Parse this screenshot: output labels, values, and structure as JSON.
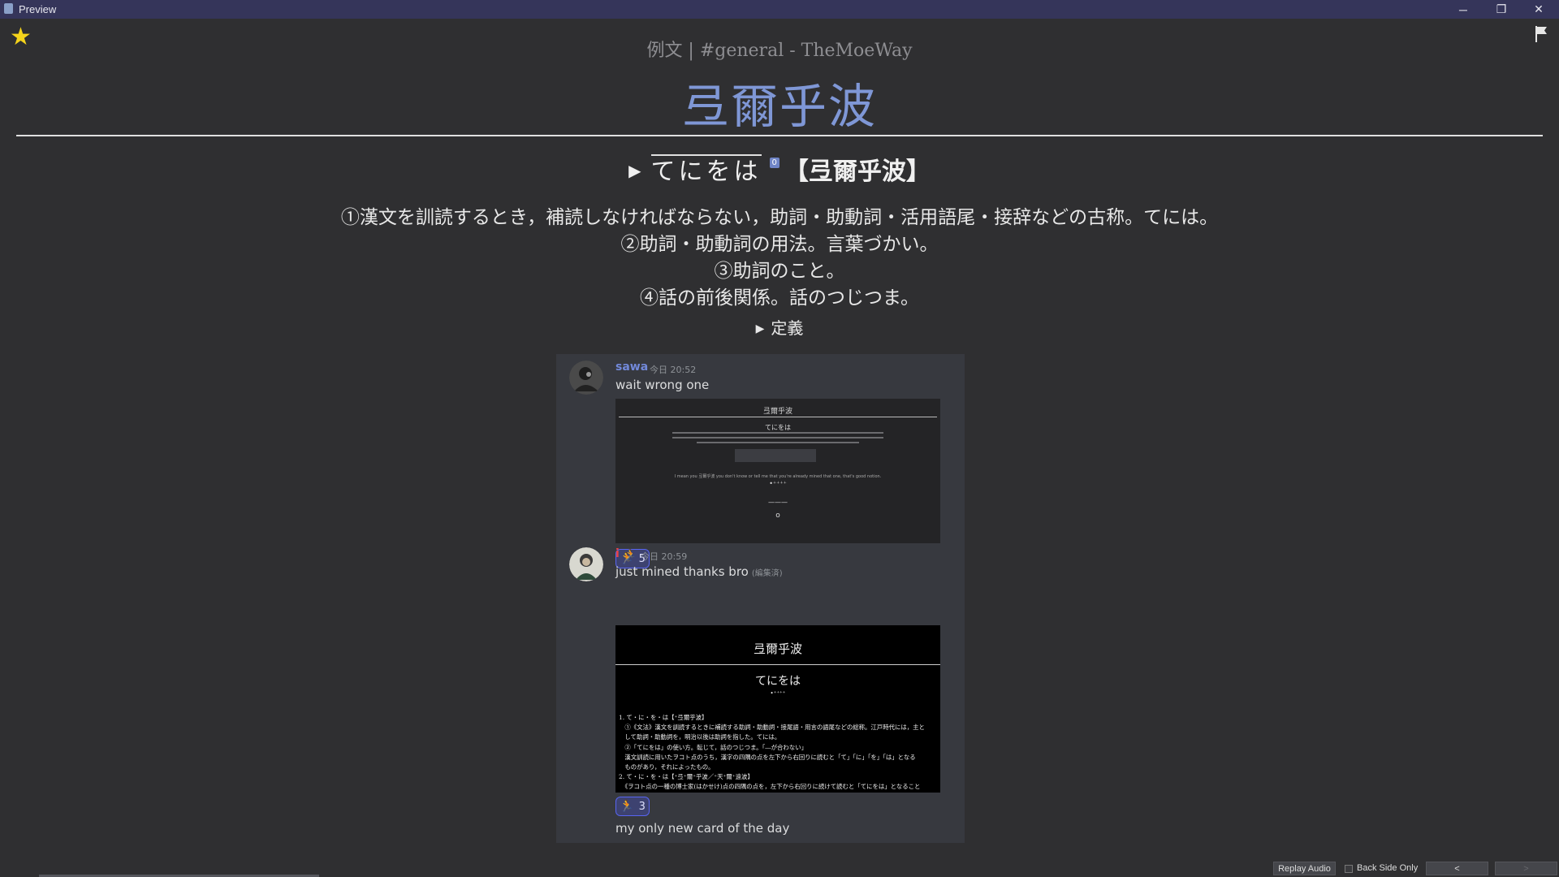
{
  "window": {
    "title": "Preview",
    "minimize_glyph": "─",
    "restore_glyph": "❐",
    "close_glyph": "✕"
  },
  "card": {
    "deck_line": "例文 | #general - TheMoeWay",
    "kanji": "弖爾乎波",
    "reading": "てにをは",
    "pitch_badge": "0",
    "headword": "【弖爾乎波】",
    "definitions": [
      "①漢文を訓読するとき，補読しなければならない，助詞・助動詞・活用語尾・接辞などの古称。てには。",
      "②助詞・助動詞の用法。言葉づかい。",
      "③助詞のこと。",
      "④話の前後関係。話のつじつま。"
    ],
    "definition_toggle": "定義"
  },
  "chat": {
    "messages": [
      {
        "author": "sawa",
        "author_color": "#7289da",
        "time": "今日 20:52",
        "text": "wait wrong one",
        "embed": {
          "title": "弖爾乎波",
          "reading": "てにをは",
          "small_text": "I mean you 弖爾乎波 you don't know or tell me that you're already mined that one, that's good notion.",
          "pitch": "•⁺⁺⁺⁺",
          "dash": "———",
          "ring": "o"
        },
        "reaction_count": "5"
      },
      {
        "author": "i",
        "author_color": "#ed4245",
        "time": "今日 20:59",
        "text": "just mined thanks bro",
        "edited": "(編集済)",
        "embed": {
          "title": "弖爾乎波",
          "reading": "てにをは",
          "pitch": "•⁺⁺⁺⁺",
          "lines": [
            "1. て・に・を・は【⁺弖爾乎波】",
            "　①《文法》漢文を訓読するときに補読する助詞・助動詞・接尾語・用言の語尾などの総称。江戸時代には，主と",
            "　して助詞・助動詞を，明治以後は助詞を指した。てには。",
            "　②「てにをは」の使い方。転じて，話のつじつま。「―が合わない」",
            "　漢文訓読に用いたヲコト点のうち，漢字の四隅の点を左下から右回りに読むと「て」「に」「を」「は」となる",
            "　ものがあり，それによったもの。",
            "2. て・に・を・は【⁺弖⁺爾⁺乎波／⁺天⁺爾⁺遠波】",
            "　《ヲコト点の一種の博士家(はかせけ)点の四隅の点を，左下から右回りに続けて読むと「てにをは」となること"
          ]
        },
        "reaction_count": "3"
      }
    ],
    "trailing_text": "my only new card of the day"
  },
  "bottom": {
    "replay_audio": "Replay Audio",
    "back_side_only": "Back Side Only",
    "prev": "<",
    "next": ">"
  },
  "colors": {
    "accent_blue": "#7f97d6",
    "star": "#f5d41b",
    "titlebar": "#35355a"
  }
}
